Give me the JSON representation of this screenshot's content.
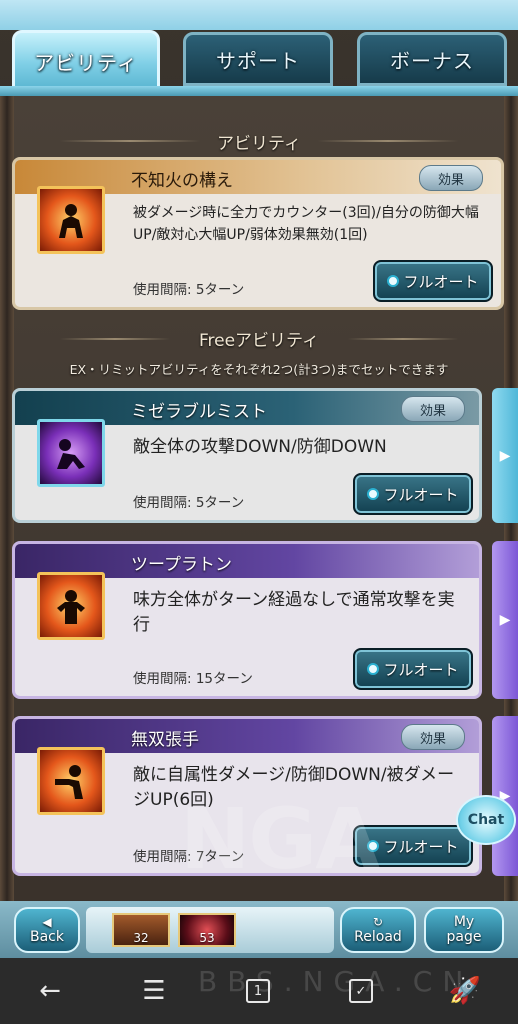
{
  "tabs": [
    {
      "label": "アビリティ",
      "active": true
    },
    {
      "label": "サポート",
      "active": false
    },
    {
      "label": "ボーナス",
      "active": false
    }
  ],
  "sections": {
    "ability_title": "アビリティ",
    "free_title": "Freeアビリティ",
    "free_notice": "EX・リミットアビリティをそれぞれ2つ(計3つ)までセットできます"
  },
  "abilities": [
    {
      "name": "不知火の構え",
      "effect_label": "効果",
      "description": "被ダメージ時に全力でカウンター(3回)/自分の防御大幅UP/敵対心大幅UP/弱体効果無効(1回)",
      "cooldown": "使用間隔: 5ターン",
      "button": "フルオート"
    },
    {
      "name": "ミゼラブルミスト",
      "effect_label": "効果",
      "description": "敵全体の攻撃DOWN/防御DOWN",
      "cooldown": "使用間隔: 5ターン",
      "button": "フルオート"
    },
    {
      "name": "ツープラトン",
      "description": "味方全体がターン経過なしで通常攻撃を実行",
      "cooldown": "使用間隔: 15ターン",
      "button": "フルオート"
    },
    {
      "name": "無双張手",
      "effect_label": "効果",
      "description": "敵に自属性ダメージ/防御DOWN/被ダメージUP(6回)",
      "cooldown": "使用間隔: 7ターン",
      "button": "フルオート"
    }
  ],
  "chat_label": "Chat",
  "watermark": "NGA",
  "bottom_bar": {
    "back": "Back",
    "reload": "Reload",
    "mypage_line1": "My",
    "mypage_line2": "page",
    "party_counts": [
      "32",
      "53"
    ]
  },
  "nav_watermark": "BBS.NGA.CN",
  "nav_icons": [
    "back-arrow-icon",
    "menu-icon",
    "tab-count-icon",
    "checklist-icon",
    "rocket-icon"
  ],
  "nav_tab_count": "1"
}
